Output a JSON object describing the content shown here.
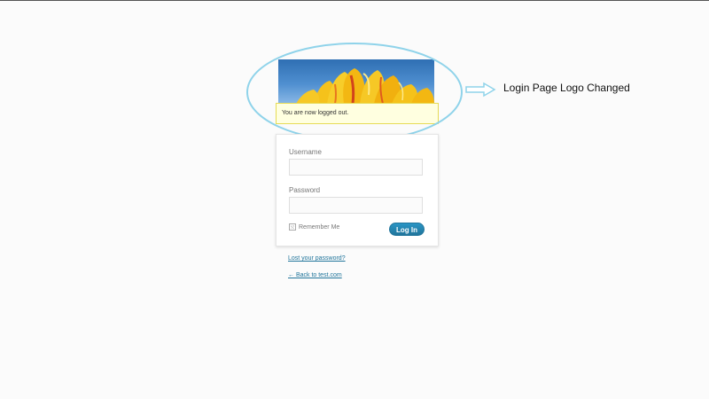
{
  "message": {
    "text": "You are now logged out."
  },
  "annotation": {
    "text": "Login Page Logo Changed",
    "color": "#8fd3ea"
  },
  "login_form": {
    "username_label": "Username",
    "username_value": "",
    "password_label": "Password",
    "password_value": "",
    "remember_label": "Remember Me",
    "remember_checked": false,
    "submit_label": "Log In"
  },
  "links": {
    "lost_password": "Lost your password?",
    "back_to_site": "← Back to test.com"
  },
  "colors": {
    "page_bg": "#fbfbfb",
    "message_bg": "#ffffe0",
    "message_border": "#e6db55",
    "button_blue": "#21759b",
    "link_blue": "#21759b",
    "logo_sky": "#2f6fb3",
    "logo_flower": "#f5c21b"
  },
  "icons": {
    "logo": "tulip-flower-logo",
    "annotation_arrow": "right-arrow-icon",
    "remember_checkbox": "checkbox-icon"
  }
}
